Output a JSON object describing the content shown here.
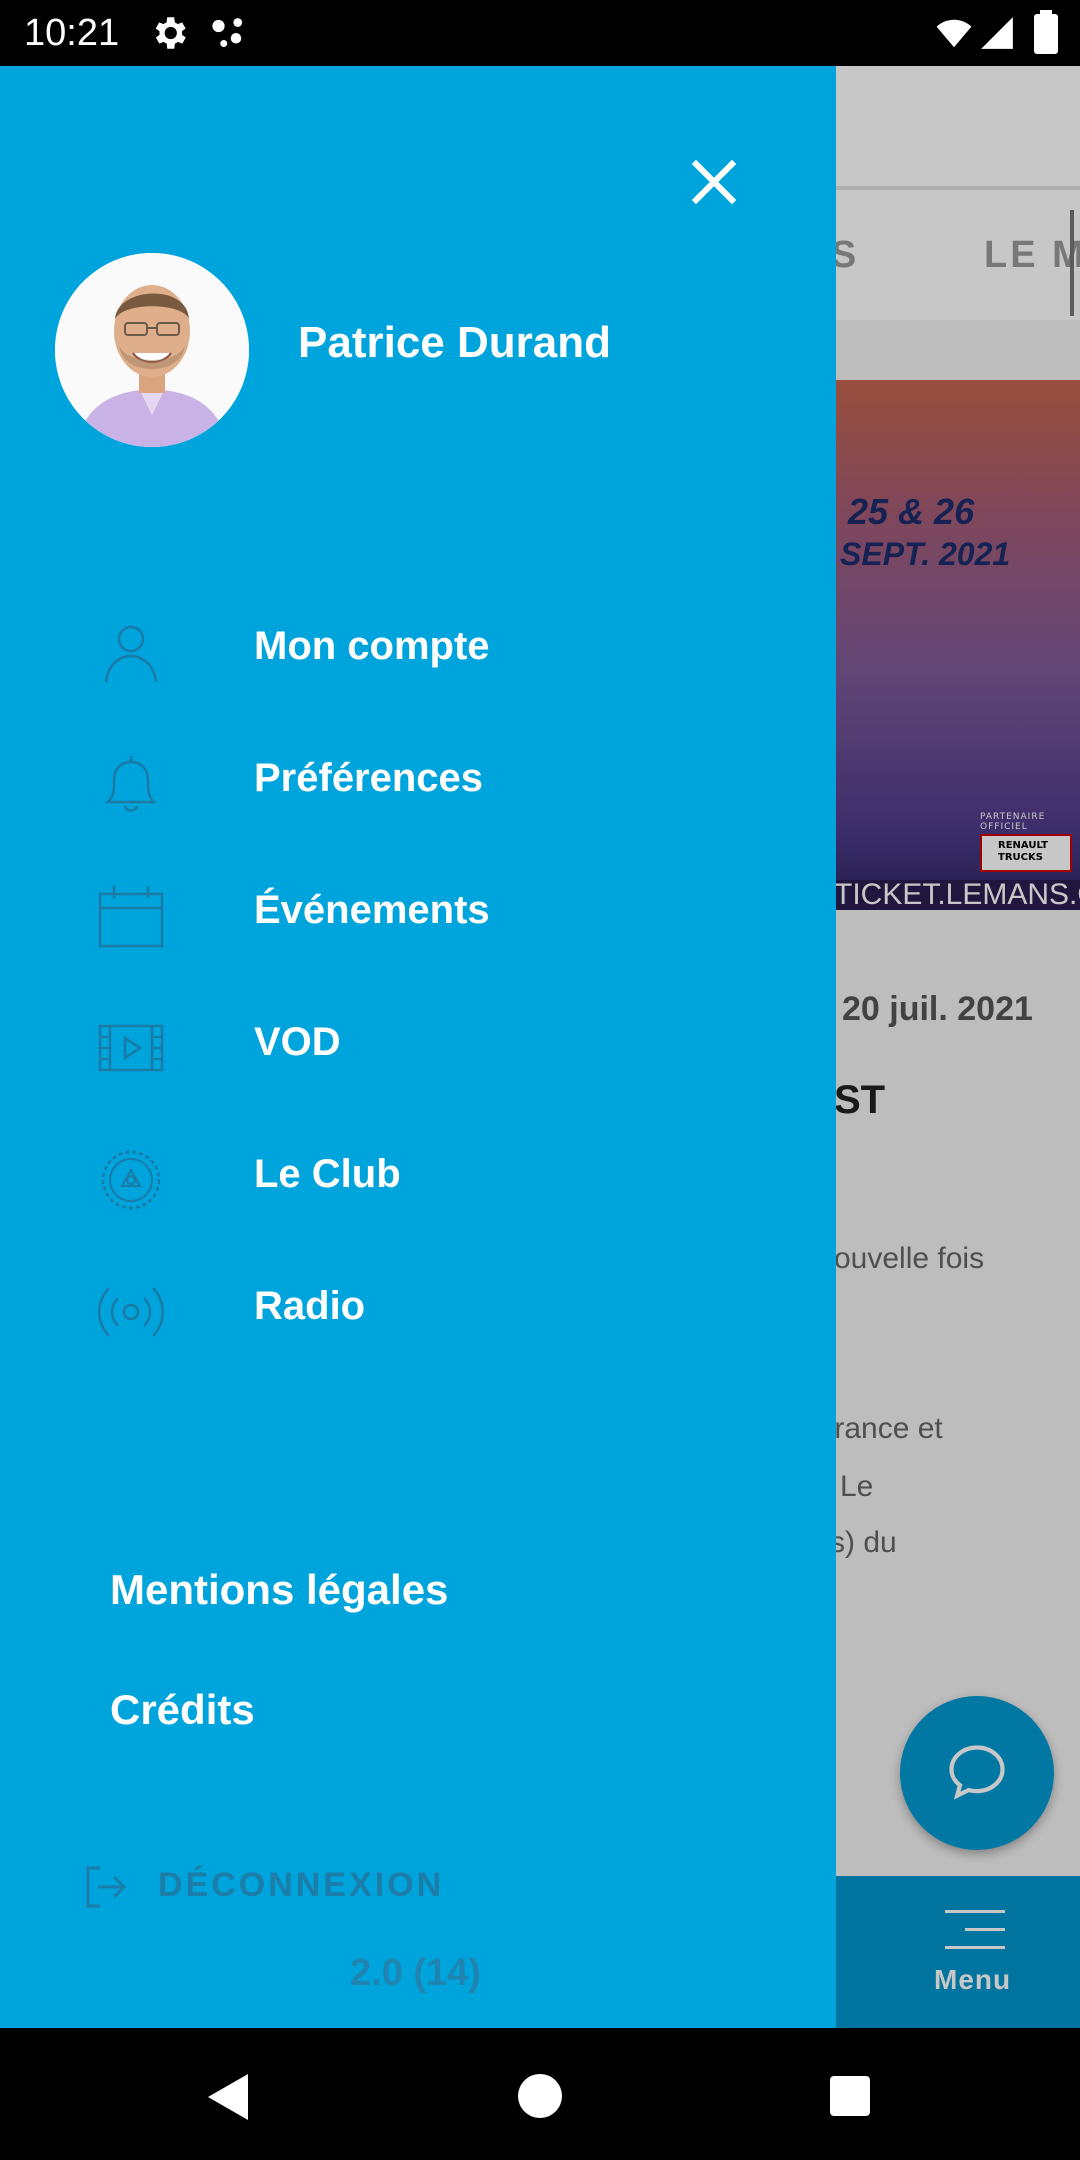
{
  "status_bar": {
    "time": "10:21"
  },
  "background_app": {
    "tabs": [
      "ANS",
      "LE M"
    ],
    "banner": {
      "date_line1": "25 & 26",
      "date_line2": "SEPT. 2021",
      "partner": "PARTENAIRE OFFICIEL",
      "logo": "RENAULT TRUCKS",
      "url": "TICKET.LEMANS.ORG"
    },
    "article": {
      "date": "20 juil. 2021",
      "title": "ST",
      "lines": [
        "ouvelle fois",
        "france et",
        "Le",
        "s) du"
      ]
    },
    "menu_label": "Menu"
  },
  "drawer": {
    "user_name": "Patrice Durand",
    "items": [
      {
        "label": "Mon compte",
        "icon": "user-icon"
      },
      {
        "label": "Préférences",
        "icon": "bell-icon"
      },
      {
        "label": "Événements",
        "icon": "calendar-icon"
      },
      {
        "label": "VOD",
        "icon": "film-icon"
      },
      {
        "label": "Le Club",
        "icon": "club-icon"
      },
      {
        "label": "Radio",
        "icon": "radio-icon"
      }
    ],
    "legal": "Mentions légales",
    "credits": "Crédits",
    "logout": "DÉCONNEXION",
    "version": "2.0 (14)"
  },
  "colors": {
    "drawer": "#00a4dd",
    "accent": "#0297cd"
  }
}
